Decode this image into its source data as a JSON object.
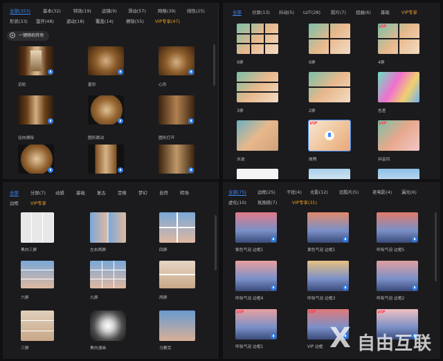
{
  "top_left": {
    "tabs": [
      "全部(353)",
      "基本(32)",
      "特效(19)",
      "运镜(9)",
      "滑动(57)",
      "网格(39)",
      "线性(25)",
      "形状(33)",
      "旋开(48)",
      "遮动(18)",
      "覆盖(14)",
      "擦除(55)",
      "VIP专享(47)"
    ],
    "random_button": "一键随机转场",
    "items": [
      "远轮",
      "星形",
      "心形",
      "径向擦除",
      "圆形跳动",
      "圆形打开",
      "",
      "",
      ""
    ]
  },
  "top_right": {
    "tabs": [
      "全部",
      "分屏(13)",
      "抖动(5)",
      "LUT(28)",
      "胶片(7)",
      "扭曲(6)",
      "基础",
      "VIP专享"
    ],
    "items": [
      "9屏",
      "6屏",
      "4屏",
      "3屏",
      "2屏",
      "色差",
      "水波",
      "故障",
      "抖音风",
      "",
      "",
      ""
    ]
  },
  "bottom_left": {
    "tabs": [
      "全部",
      "分屏(7)",
      "动感",
      "基础",
      "复古",
      "定格",
      "梦幻",
      "自然",
      "转场",
      "边框",
      "VIP专享"
    ],
    "items": [
      "黑白三屏",
      "左右两屏",
      "四屏",
      "六屏",
      "九屏",
      "两屏",
      "三屏",
      "黑白漫画",
      "马赛克"
    ]
  },
  "bottom_right": {
    "tabs": [
      "全部(75)",
      "边框(25)",
      "干扰(4)",
      "光影(12)",
      "旧胶片(5)",
      "老电影(4)",
      "漏光(6)",
      "虚化(10)",
      "氛围感(7)",
      "VIP专享(31)"
    ],
    "items": [
      "紫色气泡 边框1",
      "黄色气泡 边框1",
      "呼吸气泡 边框5",
      "呼吸气泡 边框4",
      "呼吸气泡 边框3",
      "呼吸气泡 边框2",
      "呼吸气泡 边框1",
      "VIP 边框",
      "",
      ""
    ]
  },
  "watermark": {
    "mark": "X",
    "text": "自由互联"
  },
  "colors": {
    "accent": "#3c8dff",
    "vip": "#f0a224",
    "panel_bg": "#1b1b1e",
    "app_bg": "#0f0f11"
  },
  "icons": {
    "download": "download-icon",
    "random": "random-icon"
  }
}
